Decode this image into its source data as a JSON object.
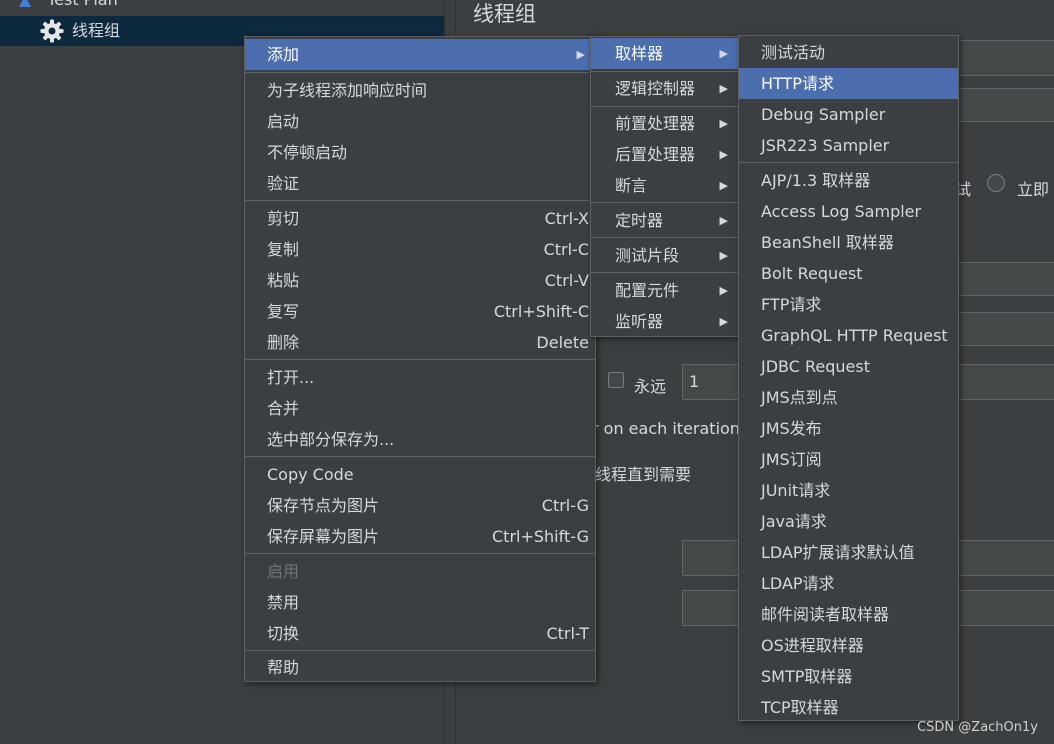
{
  "tree": {
    "root_label": "Test Plan",
    "selected_label": "线程组"
  },
  "panel": {
    "title": "线程组",
    "radio_label_1": "试",
    "radio_label_2": "立即",
    "forever_label": "永远",
    "loop_value": "1",
    "iteration_text": "r on each iteration",
    "delay_text": "线程直到需要"
  },
  "context_menu": {
    "add": "添加",
    "add_response_time": "为子线程添加响应时间",
    "start": "启动",
    "start_no_pause": "不停顿启动",
    "validate": "验证",
    "cut": "剪切",
    "cut_sc": "Ctrl-X",
    "copy": "复制",
    "copy_sc": "Ctrl-C",
    "paste": "粘贴",
    "paste_sc": "Ctrl-V",
    "duplicate": "复写",
    "duplicate_sc": "Ctrl+Shift-C",
    "delete": "删除",
    "delete_sc": "Delete",
    "open": "打开...",
    "merge": "合并",
    "save_selection": "选中部分保存为...",
    "copy_code": "Copy Code",
    "save_node_image": "保存节点为图片",
    "save_node_image_sc": "Ctrl-G",
    "save_screen_image": "保存屏幕为图片",
    "save_screen_image_sc": "Ctrl+Shift-G",
    "enable": "启用",
    "disable": "禁用",
    "toggle": "切换",
    "toggle_sc": "Ctrl-T",
    "help": "帮助"
  },
  "add_menu": {
    "sampler": "取样器",
    "logic_controller": "逻辑控制器",
    "pre_processor": "前置处理器",
    "post_processor": "后置处理器",
    "assertion": "断言",
    "timer": "定时器",
    "test_fragment": "测试片段",
    "config_element": "配置元件",
    "listener": "监听器"
  },
  "sampler_menu": {
    "items": [
      "测试活动",
      "HTTP请求",
      "Debug Sampler",
      "JSR223 Sampler",
      "AJP/1.3 取样器",
      "Access Log Sampler",
      "BeanShell 取样器",
      "Bolt Request",
      "FTP请求",
      "GraphQL HTTP Request",
      "JDBC Request",
      "JMS点到点",
      "JMS发布",
      "JMS订阅",
      "JUnit请求",
      "Java请求",
      "LDAP扩展请求默认值",
      "LDAP请求",
      "邮件阅读者取样器",
      "OS进程取样器",
      "SMTP取样器",
      "TCP取样器"
    ]
  },
  "watermark": "CSDN @ZachOn1y",
  "colors": {
    "background": "#3c3f41",
    "highlight": "#4b6eaf",
    "tree_selection": "#0d293e"
  }
}
